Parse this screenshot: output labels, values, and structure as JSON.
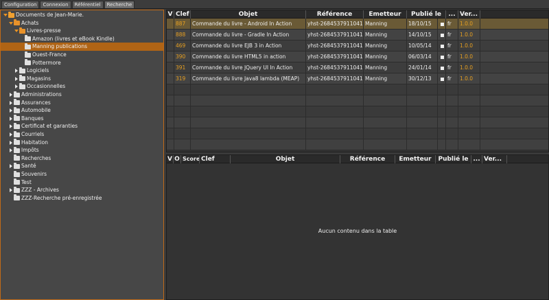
{
  "tabs": [
    "Configuration",
    "Connexion",
    "Référentiel",
    "Recherche"
  ],
  "tree": [
    {
      "label": "Documents de Jean-Marie.",
      "arrow": "down",
      "folder": "root",
      "depth": 0
    },
    {
      "label": "Achats",
      "arrow": "down",
      "folder": "open",
      "depth": 1
    },
    {
      "label": "Livres-presse",
      "arrow": "down",
      "folder": "open",
      "depth": 2
    },
    {
      "label": "Amazon (livres et eBook Kindle)",
      "arrow": "none",
      "folder": "closed",
      "depth": 3
    },
    {
      "label": "Manning publications",
      "arrow": "none",
      "folder": "closed",
      "depth": 3,
      "selected": true
    },
    {
      "label": "Ouest-France",
      "arrow": "none",
      "folder": "closed",
      "depth": 3
    },
    {
      "label": "Pottermore",
      "arrow": "none",
      "folder": "closed",
      "depth": 3
    },
    {
      "label": "Logiciels",
      "arrow": "right",
      "folder": "closed",
      "depth": 2
    },
    {
      "label": "Magasins",
      "arrow": "right",
      "folder": "closed",
      "depth": 2
    },
    {
      "label": "Occasionnelles",
      "arrow": "right",
      "folder": "closed",
      "depth": 2
    },
    {
      "label": "Administrations",
      "arrow": "right",
      "folder": "closed",
      "depth": 1
    },
    {
      "label": "Assurances",
      "arrow": "right",
      "folder": "closed",
      "depth": 1
    },
    {
      "label": "Automobile",
      "arrow": "right",
      "folder": "closed",
      "depth": 1
    },
    {
      "label": "Banques",
      "arrow": "right",
      "folder": "closed",
      "depth": 1
    },
    {
      "label": "Certificat et garanties",
      "arrow": "right",
      "folder": "closed",
      "depth": 1
    },
    {
      "label": "Courriels",
      "arrow": "right",
      "folder": "closed",
      "depth": 1
    },
    {
      "label": "Habitation",
      "arrow": "right",
      "folder": "closed",
      "depth": 1
    },
    {
      "label": "Impôts",
      "arrow": "right",
      "folder": "closed",
      "depth": 1
    },
    {
      "label": "Recherches",
      "arrow": "none",
      "folder": "closed",
      "depth": 1
    },
    {
      "label": "Santé",
      "arrow": "right",
      "folder": "closed",
      "depth": 1
    },
    {
      "label": "Souvenirs",
      "arrow": "none",
      "folder": "closed",
      "depth": 1
    },
    {
      "label": "Test",
      "arrow": "none",
      "folder": "closed",
      "depth": 1
    },
    {
      "label": "ZZZ - Archives",
      "arrow": "right",
      "folder": "closed",
      "depth": 1
    },
    {
      "label": "ZZZ-Recherche pré-enregistrée",
      "arrow": "none",
      "folder": "closed",
      "depth": 1
    }
  ],
  "top_table": {
    "headers": [
      "V",
      "Clef",
      "Objet",
      "Référence",
      "Emetteur",
      "Publié le",
      "...",
      "Ver..."
    ],
    "rows": [
      {
        "clef": "887",
        "objet": "Commande du livre - Android In Action",
        "reference": "yhst-2684537911041...",
        "emetteur": "Manning",
        "publie": "18/10/15",
        "lang": "fr",
        "version": "1.0.0",
        "selected": true
      },
      {
        "clef": "888",
        "objet": "Commande du livre - Gradle In Action",
        "reference": "yhst-2684537911041...",
        "emetteur": "Manning",
        "publie": "14/10/15",
        "lang": "fr",
        "version": "1.0.0"
      },
      {
        "clef": "469",
        "objet": "Commande du livre EJB 3 in Action",
        "reference": "yhst-2684537911041...",
        "emetteur": "Manning",
        "publie": "10/05/14",
        "lang": "fr",
        "version": "1.0.0"
      },
      {
        "clef": "390",
        "objet": "Commande du livre HTML5 in action",
        "reference": "yhst-2684537911041...",
        "emetteur": "Manning",
        "publie": "06/03/14",
        "lang": "fr",
        "version": "1.0.0"
      },
      {
        "clef": "391",
        "objet": "Commande du livre JQuery UI In Action",
        "reference": "yhst-2684537911041...",
        "emetteur": "Manning",
        "publie": "24/01/14",
        "lang": "fr",
        "version": "1.0.0"
      },
      {
        "clef": "319",
        "objet": "Commande du livre Java8 lambda (MEAP)",
        "reference": "yhst-2684537911041...",
        "emetteur": "Manning",
        "publie": "30/12/13",
        "lang": "fr",
        "version": "1.0.0"
      }
    ]
  },
  "bottom_table": {
    "headers": [
      "V",
      "O",
      "Score",
      "Clef",
      "Objet",
      "Référence",
      "Emetteur",
      "Publié le",
      "...",
      "Ver..."
    ],
    "empty_message": "Aucun contenu dans la table"
  },
  "colors": {
    "accent": "#c26a17",
    "selected_row": "#b06415",
    "value_orange": "#e8a020"
  }
}
